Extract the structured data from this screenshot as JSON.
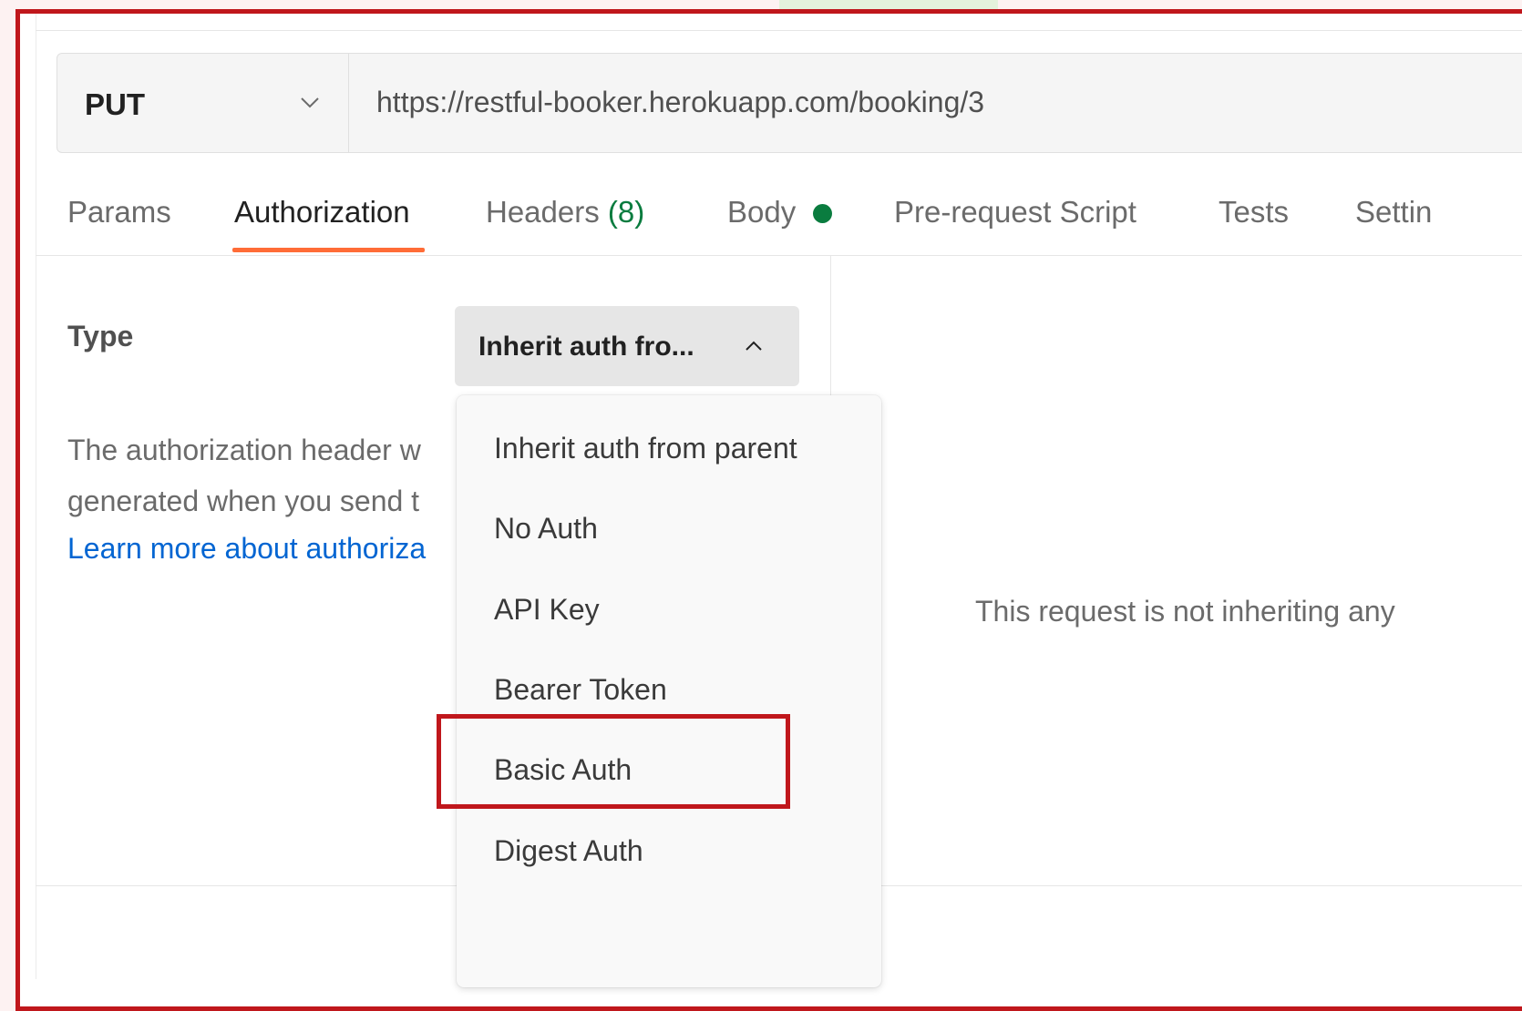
{
  "request": {
    "method": "PUT",
    "url": "https://restful-booker.herokuapp.com/booking/3"
  },
  "tabs": [
    {
      "label": "Params"
    },
    {
      "label": "Authorization",
      "active": true
    },
    {
      "label": "Headers",
      "count": "(8)"
    },
    {
      "label": "Body"
    },
    {
      "label": "Pre-request Script"
    },
    {
      "label": "Tests"
    },
    {
      "label": "Settin"
    }
  ],
  "auth": {
    "type_label": "Type",
    "selected": "Inherit auth fro...",
    "description_line1": "The authorization header w",
    "description_line2": "generated when you send t",
    "learn_more": "Learn more about authoriza"
  },
  "menu": {
    "items": [
      "Inherit auth from parent",
      "No Auth",
      "API Key",
      "Bearer Token",
      "Basic Auth",
      "Digest Auth"
    ],
    "highlighted": "Basic Auth"
  },
  "right_panel": {
    "message": "This request is not inheriting any"
  },
  "colors": {
    "accent_underline": "#ff6c37",
    "headers_count": "#0a7c3f",
    "link": "#0265d2",
    "highlight_border": "#c0171c"
  }
}
